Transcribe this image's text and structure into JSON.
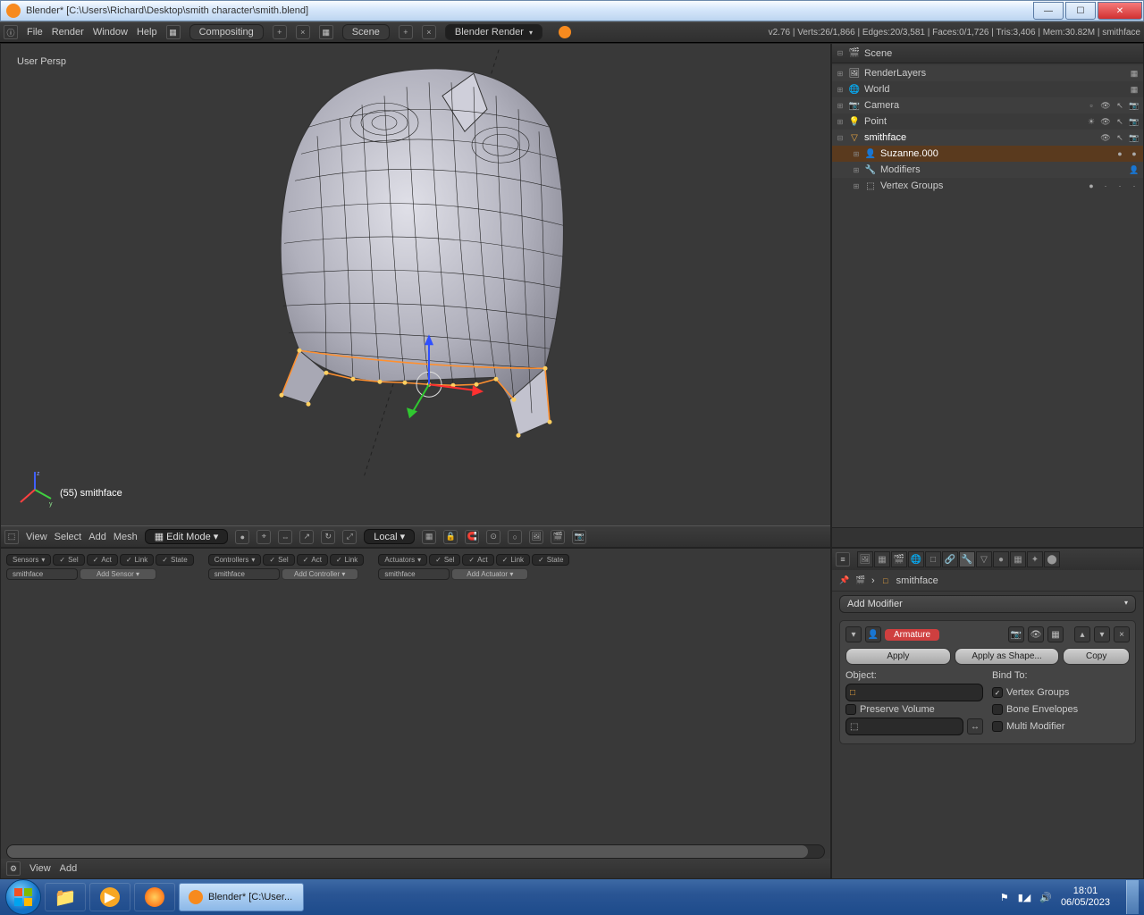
{
  "window": {
    "title": "Blender* [C:\\Users\\Richard\\Desktop\\smith character\\smith.blend]"
  },
  "header": {
    "menus": [
      "File",
      "Render",
      "Window",
      "Help"
    ],
    "screen_layout": "Compositing",
    "scene": "Scene",
    "render_engine": "Blender Render",
    "stats": "v2.76 | Verts:26/1,866 | Edges:20/3,581 | Faces:0/1,726 | Tris:3,406 | Mem:30.82M | smithface"
  },
  "viewport": {
    "view_label": "User Persp",
    "object_label": "(55) smithface",
    "menus": [
      "View",
      "Select",
      "Add",
      "Mesh"
    ],
    "mode": "Edit Mode",
    "orientation": "Local"
  },
  "outliner": {
    "scene": "Scene",
    "items": [
      {
        "name": "RenderLayers",
        "icon": "🖼"
      },
      {
        "name": "World",
        "icon": "🌐"
      },
      {
        "name": "Camera",
        "icon": "📷"
      },
      {
        "name": "Point",
        "icon": "💡"
      },
      {
        "name": "smithface",
        "icon": "▽",
        "sel": true
      },
      {
        "name": "Suzanne.000",
        "icon": "👤",
        "indent": 1
      },
      {
        "name": "Modifiers",
        "icon": "🔧",
        "indent": 1
      },
      {
        "name": "Vertex Groups",
        "icon": "⬚",
        "indent": 1
      }
    ]
  },
  "logic": {
    "sensors": {
      "title": "Sensors",
      "opts": [
        "Sel",
        "Act",
        "Link",
        "State"
      ],
      "obj": "smithface",
      "add": "Add Sensor"
    },
    "controllers": {
      "title": "Controllers",
      "opts": [
        "Sel",
        "Act",
        "Link"
      ],
      "obj": "smithface",
      "add": "Add Controller"
    },
    "actuators": {
      "title": "Actuators",
      "opts": [
        "Sel",
        "Act",
        "Link",
        "State"
      ],
      "obj": "smithface",
      "add": "Add Actuator"
    },
    "footer_menus": [
      "View",
      "Add"
    ]
  },
  "properties": {
    "crumb_object": "smithface",
    "add_modifier": "Add Modifier",
    "modifier": {
      "name": "Armature",
      "apply": "Apply",
      "apply_shape": "Apply as Shape...",
      "copy": "Copy",
      "object_label": "Object:",
      "bind_label": "Bind To:",
      "preserve_volume": "Preserve Volume",
      "vertex_groups": "Vertex Groups",
      "bone_envelopes": "Bone Envelopes",
      "multi_modifier": "Multi Modifier"
    }
  },
  "taskbar": {
    "active_app": "Blender* [C:\\User...",
    "time": "18:01",
    "date": "06/05/2023"
  }
}
